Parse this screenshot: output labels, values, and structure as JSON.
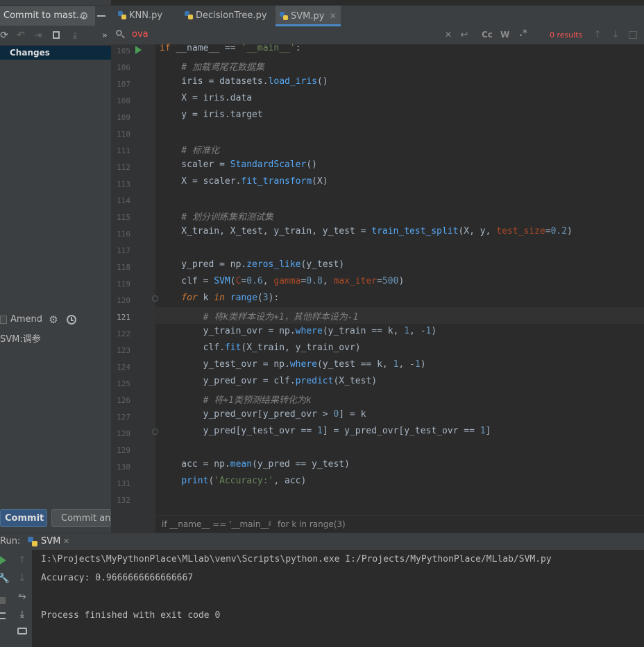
{
  "left_panel": {
    "commit_tab": "Commit to mast...",
    "changes_node": "Changes",
    "amend_label": "Amend",
    "commit_message": "SVM:调参",
    "commit_button": "Commit",
    "commit_and_button": "Commit and"
  },
  "tabs": [
    {
      "label": "KNN.py"
    },
    {
      "label": "DecisionTree.py"
    },
    {
      "label": "SVM.py"
    }
  ],
  "search": {
    "query": "ova",
    "cc": "Cc",
    "w": "W",
    "regex": ".*",
    "results": "0 results"
  },
  "editor": {
    "line_numbers": [
      "105",
      "106",
      "107",
      "108",
      "109",
      "110",
      "111",
      "112",
      "113",
      "114",
      "115",
      "116",
      "117",
      "118",
      "119",
      "120",
      "121",
      "122",
      "123",
      "124",
      "125",
      "126",
      "127",
      "128",
      "129",
      "130",
      "131",
      "132"
    ],
    "breadcrumb_1": "if __name__ == '__main__'",
    "breadcrumb_sep": "›",
    "breadcrumb_2": "for k in range(3)"
  },
  "run": {
    "label": "Run:",
    "tab": "SVM",
    "lines": [
      "I:\\Projects\\MyPythonPlace\\MLlab\\venv\\Scripts\\python.exe I:/Projects/MyPythonPlace/MLlab/SVM.py",
      "Accuracy: 0.9666666666666667",
      "",
      "Process finished with exit code 0"
    ]
  },
  "colors": {
    "editor_bg": "#2b2b2b",
    "panel_bg": "#3c3f41",
    "keyword": "#cc7832",
    "string": "#6a8759",
    "number": "#6897bb",
    "function": "#56a8f5",
    "comment": "#808080",
    "search_no_match": "#ff5555"
  }
}
